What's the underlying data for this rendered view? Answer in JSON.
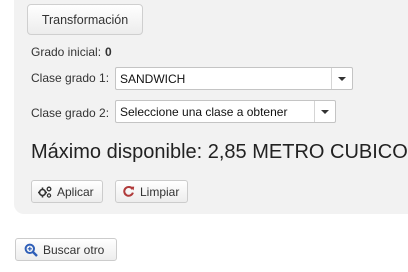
{
  "tab": {
    "label": "Transformación"
  },
  "grado_inicial": {
    "label": "Grado inicial:",
    "value": "0"
  },
  "clase_grado_1": {
    "label": "Clase grado 1:",
    "selected": "SANDWICH"
  },
  "clase_grado_2": {
    "label": "Clase grado 2:",
    "selected": "Seleccione una clase a obtener"
  },
  "maximo": {
    "text": "Máximo disponible: 2,85 METRO CUBICO"
  },
  "buttons": {
    "aplicar": "Aplicar",
    "limpiar": "Limpiar",
    "buscar_otro": "Buscar otro"
  },
  "colors": {
    "panel_bg": "#f2f2f2",
    "refresh_icon": "#b03a3a",
    "search_icon": "#2f5fb8"
  },
  "icons": {
    "aplicar": "gears-icon",
    "limpiar": "refresh-icon",
    "buscar_otro": "search-icon"
  }
}
